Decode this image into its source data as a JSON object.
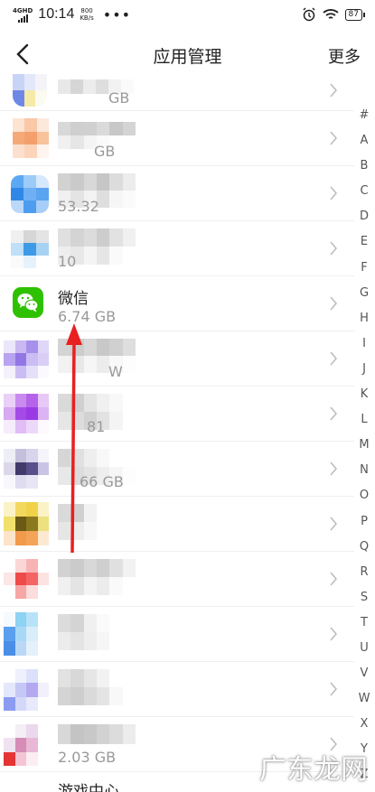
{
  "status_bar": {
    "network": "4GHD",
    "time": "10:14",
    "speed_value": "800",
    "speed_unit": "KB/s",
    "overflow": "•••",
    "battery": "87"
  },
  "nav": {
    "title": "应用管理",
    "more_label": "更多"
  },
  "apps": [
    {
      "name": "",
      "size": "GB"
    },
    {
      "name": "",
      "size": "GB"
    },
    {
      "name": "",
      "size": "53.32"
    },
    {
      "name": "",
      "size": "10"
    },
    {
      "name": "微信",
      "size": "6.74 GB"
    },
    {
      "name": "",
      "size": "W"
    },
    {
      "name": "",
      "size": "81"
    },
    {
      "name": "",
      "size": "66 GB"
    },
    {
      "name": "",
      "size": ""
    },
    {
      "name": "",
      "size": ""
    },
    {
      "name": "",
      "size": ""
    },
    {
      "name": "",
      "size": ""
    },
    {
      "name": "",
      "size": "2.03 GB"
    }
  ],
  "last_row_name": "游戏中心",
  "index_letters": [
    "#",
    "A",
    "B",
    "C",
    "D",
    "E",
    "F",
    "G",
    "H",
    "I",
    "J",
    "K",
    "L",
    "M",
    "N",
    "O",
    "P",
    "Q",
    "R",
    "S",
    "T",
    "U",
    "V",
    "W",
    "X",
    "Y",
    "Z"
  ],
  "watermark": "广东龙网",
  "colors": {
    "wechat_green": "#2DC100",
    "arrow_red": "#E82020"
  }
}
